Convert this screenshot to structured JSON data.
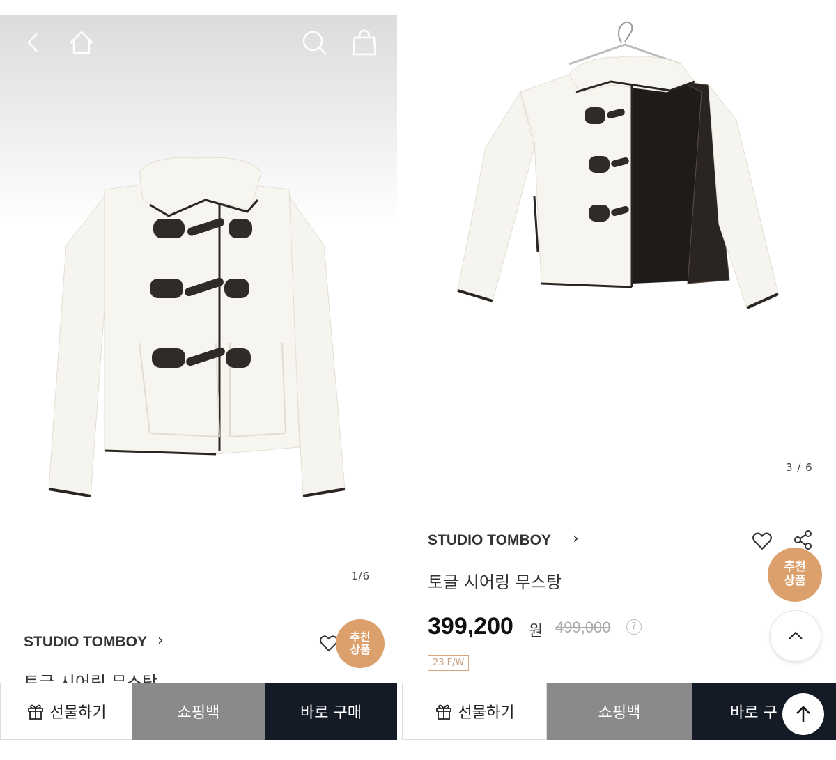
{
  "left": {
    "counter": "1/6",
    "brand": "STUDIO TOMBOY",
    "product_name": "토글 시어링 무스탕",
    "recommend_badge": [
      "추천",
      "상품"
    ],
    "bottom": {
      "gift": "선물하기",
      "bag": "쇼핑백",
      "buy": "바로 구매"
    }
  },
  "right": {
    "counter": "3 / 6",
    "brand": "STUDIO TOMBOY",
    "product_name": "토글 시어링 무스탕",
    "price": "399,200",
    "currency": "원",
    "original_price": "499,000",
    "help": "?",
    "season_tag": "23 F/W",
    "recommend_badge": [
      "추천",
      "상품"
    ],
    "bottom": {
      "gift": "선물하기",
      "bag": "쇼핑백",
      "buy": "바로 구"
    }
  },
  "icons": {
    "back": "back-arrow-icon",
    "home": "home-icon",
    "search": "search-icon",
    "cart": "shopping-bag-icon",
    "heart": "heart-icon",
    "share": "share-icon",
    "gift": "gift-icon",
    "up": "chevron-up-icon",
    "top": "arrow-up-icon"
  },
  "colors": {
    "accent": "#dca06c",
    "buy_bg": "#141b26",
    "bag_bg": "#8a8a8a"
  }
}
